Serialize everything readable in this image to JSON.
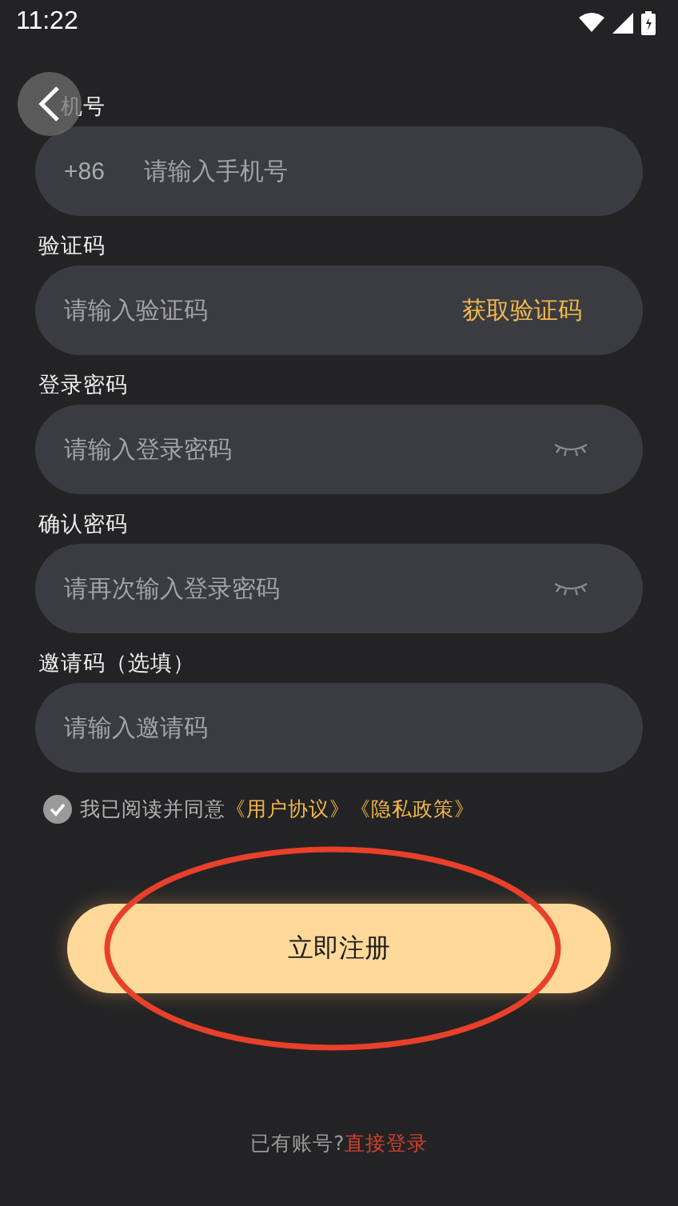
{
  "status_bar": {
    "time": "11:22"
  },
  "fields": [
    {
      "kind": "phone",
      "label": "机号",
      "prefix": "+86",
      "placeholder": "请输入手机号"
    },
    {
      "kind": "code",
      "label": "验证码",
      "placeholder": "请输入验证码",
      "action": "获取验证码"
    },
    {
      "kind": "password",
      "label": "登录密码",
      "placeholder": "请输入登录密码"
    },
    {
      "kind": "password",
      "label": "确认密码",
      "placeholder": "请再次输入登录密码"
    },
    {
      "kind": "plain",
      "label": "邀请码（选填）",
      "placeholder": "请输入邀请码"
    }
  ],
  "agreement": {
    "checked": true,
    "text": "我已阅读并同意",
    "links": [
      "《用户协议》",
      "《隐私政策》"
    ]
  },
  "register_button": "立即注册",
  "footer": {
    "text": "已有账号?",
    "link": "直接登录"
  }
}
